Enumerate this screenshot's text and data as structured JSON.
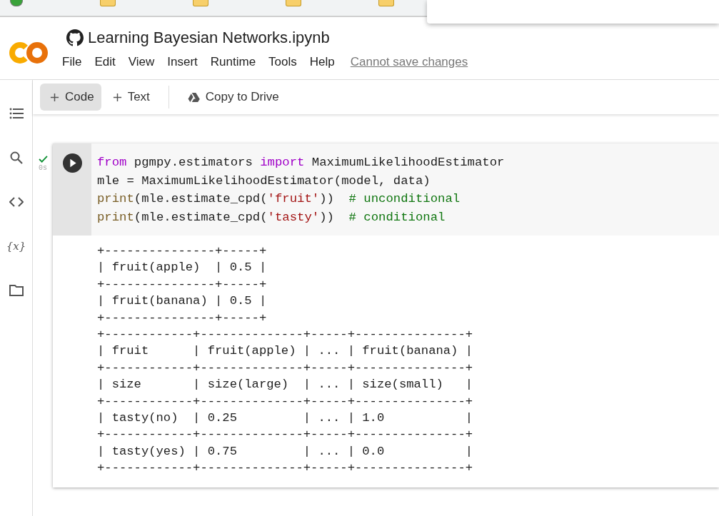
{
  "notebook": {
    "title": "Learning Bayesian Networks.ipynb",
    "menu": [
      "File",
      "Edit",
      "View",
      "Insert",
      "Runtime",
      "Tools",
      "Help"
    ],
    "save_status": "Cannot save changes"
  },
  "toolbar": [
    {
      "kind": "add",
      "label": "Code",
      "selected": true
    },
    {
      "kind": "add",
      "label": "Text",
      "selected": false
    },
    {
      "kind": "drive",
      "label": "Copy to Drive",
      "selected": false
    }
  ],
  "sidebar": [
    {
      "kind": "toc"
    },
    {
      "kind": "search"
    },
    {
      "kind": "code"
    },
    {
      "kind": "variables",
      "label": "{x}"
    },
    {
      "kind": "files"
    }
  ],
  "cell": {
    "executed": true,
    "duration": "0s",
    "code": [
      [
        {
          "kind": "keyword",
          "text": "from"
        },
        {
          "kind": "plain",
          "text": " pgmpy.estimators "
        },
        {
          "kind": "keyword",
          "text": "import"
        },
        {
          "kind": "plain",
          "text": " MaximumLikelihoodEstimator"
        }
      ],
      [
        {
          "kind": "plain",
          "text": "mle = MaximumLikelihoodEstimator(model, data)"
        }
      ],
      [
        {
          "kind": "builtin",
          "text": "print"
        },
        {
          "kind": "plain",
          "text": "(mle.estimate_cpd("
        },
        {
          "kind": "string",
          "text": "'fruit'"
        },
        {
          "kind": "plain",
          "text": "))  "
        },
        {
          "kind": "comment",
          "text": "# unconditional"
        }
      ],
      [
        {
          "kind": "builtin",
          "text": "print"
        },
        {
          "kind": "plain",
          "text": "(mle.estimate_cpd("
        },
        {
          "kind": "string",
          "text": "'tasty'"
        },
        {
          "kind": "plain",
          "text": "))  "
        },
        {
          "kind": "comment",
          "text": "# conditional"
        }
      ]
    ],
    "output": [
      "+---------------+-----+",
      "| fruit(apple)  | 0.5 |",
      "+---------------+-----+",
      "| fruit(banana) | 0.5 |",
      "+---------------+-----+",
      "+------------+--------------+-----+---------------+",
      "| fruit      | fruit(apple) | ... | fruit(banana) |",
      "+------------+--------------+-----+---------------+",
      "| size       | size(large)  | ... | size(small)   |",
      "+------------+--------------+-----+---------------+",
      "| tasty(no)  | 0.25         | ... | 1.0           |",
      "+------------+--------------+-----+---------------+",
      "| tasty(yes) | 0.75         | ... | 0.0           |",
      "+------------+--------------+-----+---------------+"
    ]
  }
}
